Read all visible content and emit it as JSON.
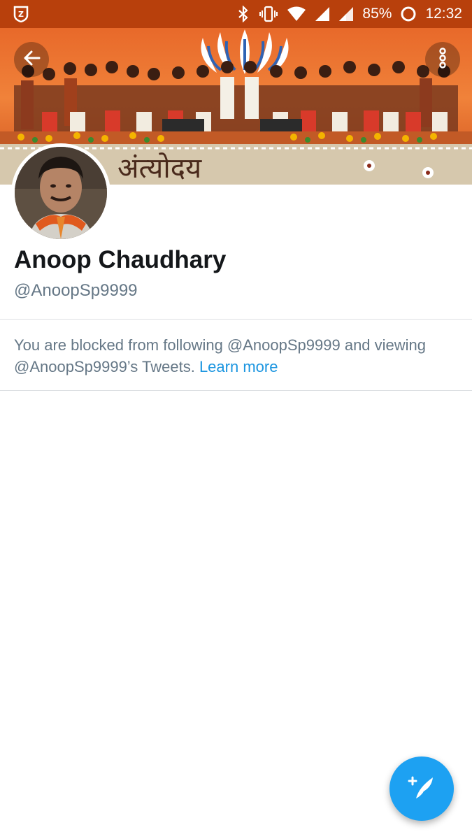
{
  "status_bar": {
    "battery_percent": "85%",
    "time": "12:32",
    "icons": [
      "app-badge-icon",
      "bluetooth-icon",
      "vibrate-icon",
      "wifi-icon",
      "cell-signal-icon",
      "cell-signal-icon",
      "battery-ring-icon"
    ]
  },
  "banner": {
    "back_icon": "arrow-left-icon",
    "more_icon": "more-vertical-icon",
    "banner_text": "अंत्योदय"
  },
  "profile": {
    "name": "Anoop Chaudhary",
    "handle": "@AnoopSp9999"
  },
  "notice": {
    "text": "You are blocked from following @AnoopSp9999 and viewing @AnoopSp9999’s Tweets. ",
    "link": "Learn more"
  },
  "fab": {
    "icon": "compose-tweet-icon"
  },
  "colors": {
    "status_bar": "#b8400c",
    "link": "#1b95e0",
    "fab": "#1da1f2",
    "secondary_text": "#657786"
  }
}
